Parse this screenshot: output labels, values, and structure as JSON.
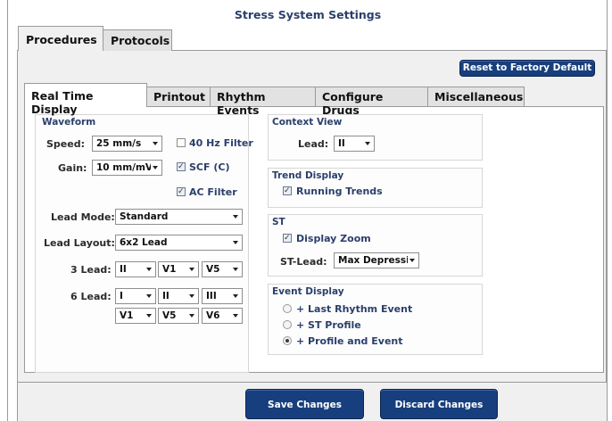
{
  "window": {
    "title": "Stress System Settings"
  },
  "tabs_outer": [
    {
      "label": "Procedures",
      "active": true
    },
    {
      "label": "Protocols",
      "active": false
    }
  ],
  "reset_label": "Reset to Factory Default",
  "tabs_inner": [
    {
      "label": "Real Time Display",
      "active": true
    },
    {
      "label": "Printout",
      "active": false
    },
    {
      "label": "Rhythm Events",
      "active": false
    },
    {
      "label": "Configure Drugs",
      "active": false
    },
    {
      "label": "Miscellaneous",
      "active": false
    }
  ],
  "waveform": {
    "title": "Waveform",
    "speed_label": "Speed:",
    "speed_value": "25 mm/s",
    "gain_label": "Gain:",
    "gain_value": "10 mm/mV",
    "filter40_label": "40 Hz Filter",
    "filter40_checked": false,
    "scf_label": "SCF (C)",
    "scf_checked": true,
    "ac_label": "AC Filter",
    "ac_checked": true
  },
  "lead_mode": {
    "label": "Lead Mode:",
    "value": "Standard"
  },
  "lead_layout": {
    "label": "Lead Layout:",
    "value": "6x2 Lead"
  },
  "three_lead": {
    "label": "3 Lead:",
    "values": [
      "II",
      "V1",
      "V5"
    ]
  },
  "six_lead": {
    "label": "6 Lead:",
    "row1": [
      "I",
      "II",
      "III"
    ],
    "row2": [
      "V1",
      "V5",
      "V6"
    ]
  },
  "context_view": {
    "title": "Context View",
    "lead_label": "Lead:",
    "lead_value": "II"
  },
  "trend_display": {
    "title": "Trend Display",
    "running_label": "Running Trends",
    "running_checked": true
  },
  "st": {
    "title": "ST",
    "zoom_label": "Display Zoom",
    "zoom_checked": true,
    "stlead_label": "ST-Lead:",
    "stlead_value": "Max Depression"
  },
  "event_display": {
    "title": "Event Display",
    "options": [
      {
        "label": "+ Last Rhythm Event",
        "selected": false
      },
      {
        "label": "+ ST Profile",
        "selected": false
      },
      {
        "label": "+ Profile and Event",
        "selected": true
      }
    ]
  },
  "footer": {
    "save_label": "Save Changes",
    "discard_label": "Discard Changes"
  },
  "colors": {
    "accent": "#173f7d",
    "heading": "#2a3f6b",
    "panel": "#f0f0f0"
  }
}
